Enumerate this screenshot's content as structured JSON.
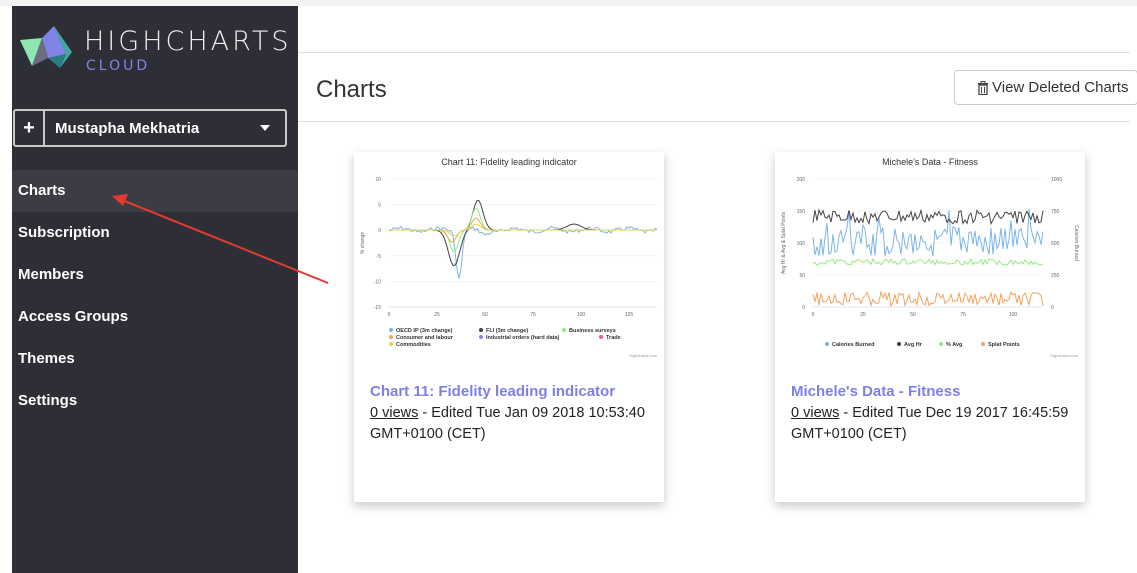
{
  "brand": {
    "name": "HIGHCHARTS",
    "sub": "CLOUD"
  },
  "account": {
    "add_label": "+",
    "name": "Mustapha Mekhatria"
  },
  "sidebar": {
    "items": [
      {
        "label": "Charts",
        "active": true
      },
      {
        "label": "Subscription"
      },
      {
        "label": "Members"
      },
      {
        "label": "Access Groups"
      },
      {
        "label": "Themes"
      },
      {
        "label": "Settings"
      }
    ]
  },
  "header": {
    "title": "Charts",
    "view_deleted_label": "View Deleted Charts",
    "view_deleted_icon": "trash-icon"
  },
  "charts": [
    {
      "name": "Chart 11: Fidelity leading indicator",
      "views": "0 views",
      "edited": " - Edited Tue Jan 09 2018 10:53:40 GMT+0100 (CET)",
      "thumb": {
        "title": "Chart 11: Fidelity leading indicator",
        "ylabel": "% change",
        "yticks": [
          "10",
          "5",
          "0",
          "-5",
          "-10",
          "-15"
        ],
        "xticks": [
          "0",
          "25",
          "50",
          "75",
          "100",
          "125"
        ],
        "legend": [
          {
            "label": "OECD IP (3m change)",
            "color": "#7cb5ec"
          },
          {
            "label": "FLI (3m change)",
            "color": "#434348"
          },
          {
            "label": "Business surveys",
            "color": "#90ed7d"
          },
          {
            "label": "Consumer and labour",
            "color": "#f7a35c"
          },
          {
            "label": "Industrial orders (hard data)",
            "color": "#8085e9"
          },
          {
            "label": "Trade",
            "color": "#f15c80"
          },
          {
            "label": "Commodities",
            "color": "#e4d354"
          }
        ],
        "credits": "Highcharts.com"
      }
    },
    {
      "name": "Michele's Data - Fitness",
      "views": "0 views",
      "edited": " - Edited Tue Dec 19 2017 16:45:59 GMT+0100 (CET)",
      "thumb": {
        "title": "Michele's Data - Fitness",
        "ylabel": "Avg Hr & Avg & Splat Points",
        "ylabel_right": "Calories Burned",
        "yticks": [
          "200",
          "150",
          "100",
          "50",
          "0"
        ],
        "yticks_right": [
          "1000",
          "750",
          "500",
          "250",
          "0"
        ],
        "xticks": [
          "0",
          "25",
          "50",
          "75",
          "100"
        ],
        "legend": [
          {
            "label": "Calories Burned",
            "color": "#7cb5ec"
          },
          {
            "label": "Avg Hr",
            "color": "#434348"
          },
          {
            "label": "% Avg",
            "color": "#90ed7d"
          },
          {
            "label": "Splat Points",
            "color": "#f7a35c"
          }
        ],
        "credits": "Highcharts.com"
      }
    }
  ],
  "colors": {
    "sidebar": "#2e2f36",
    "accent": "#7c80e8",
    "annotation_arrow": "#e53a2e"
  }
}
